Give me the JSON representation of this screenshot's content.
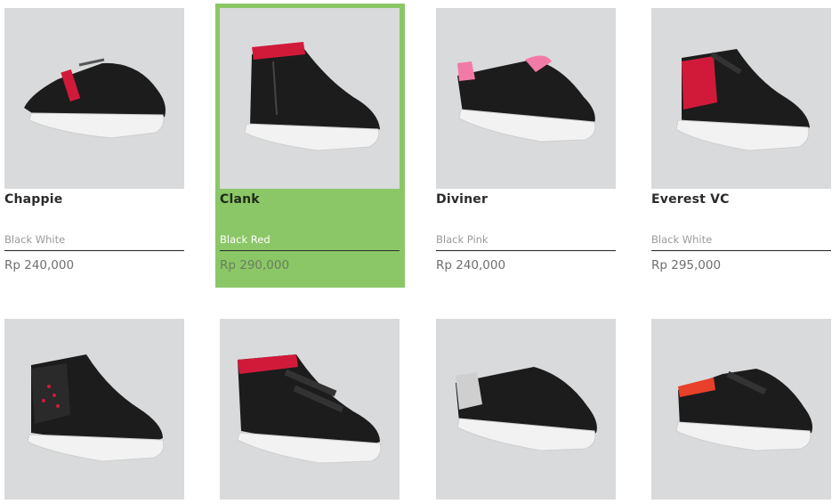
{
  "products": [
    {
      "name": "Chappie",
      "variant": "Black White",
      "price": "Rp 240,000",
      "accent": "#d11a3a",
      "collar": "#1a1a1a"
    },
    {
      "name": "Clank",
      "variant": "Black Red",
      "price": "Rp 290,000",
      "accent": "#d11a3a",
      "collar": "#d11a3a"
    },
    {
      "name": "Diviner",
      "variant": "Black Pink",
      "price": "Rp 240,000",
      "accent": "#f27aa6",
      "collar": "#1a1a1a"
    },
    {
      "name": "Everest VC",
      "variant": "Black White",
      "price": "Rp 295,000",
      "accent": "#d11a3a",
      "collar": "#d11a3a"
    },
    {
      "name": "",
      "variant": "",
      "price": "",
      "accent": "#d11a3a",
      "collar": "#1a1a1a"
    },
    {
      "name": "",
      "variant": "",
      "price": "",
      "accent": "#d11a3a",
      "collar": "#d11a3a"
    },
    {
      "name": "",
      "variant": "",
      "price": "",
      "accent": "#cfcfcf",
      "collar": "#1a1a1a"
    },
    {
      "name": "",
      "variant": "",
      "price": "",
      "accent": "#e8402a",
      "collar": "#e8402a"
    }
  ],
  "colors": {
    "highlight": "#8bc766",
    "image_bg": "#d9dadb"
  }
}
